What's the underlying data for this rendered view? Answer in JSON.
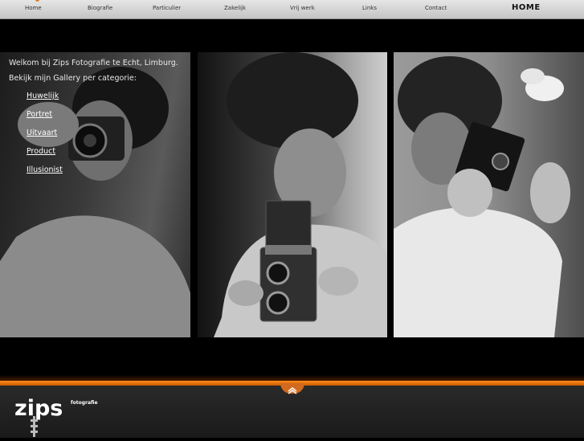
{
  "nav": {
    "items": [
      {
        "label": "Home"
      },
      {
        "label": "Biografie"
      },
      {
        "label": "Particulier"
      },
      {
        "label": "Zakelijk"
      },
      {
        "label": "Vrij werk"
      },
      {
        "label": "Links"
      },
      {
        "label": "Contact"
      }
    ],
    "page_title": "HOME"
  },
  "intro": {
    "welcome": "Welkom bij Zips Fotografie te Echt, Limburg.",
    "gallery_prompt": "Bekijk mijn Gallery per categorie:"
  },
  "categories": [
    {
      "label": "Huwelijk"
    },
    {
      "label": "Portret"
    },
    {
      "label": "Uitvaart"
    },
    {
      "label": "Product"
    },
    {
      "label": "Illusionist"
    }
  ],
  "footer": {
    "logo_text": "zips",
    "logo_subtext": "fotografie"
  },
  "colors": {
    "background": "#000000",
    "accent": "#f07a10",
    "nav_bar": "#d6d6d6"
  },
  "icons": [
    "up-arrow-icon"
  ]
}
